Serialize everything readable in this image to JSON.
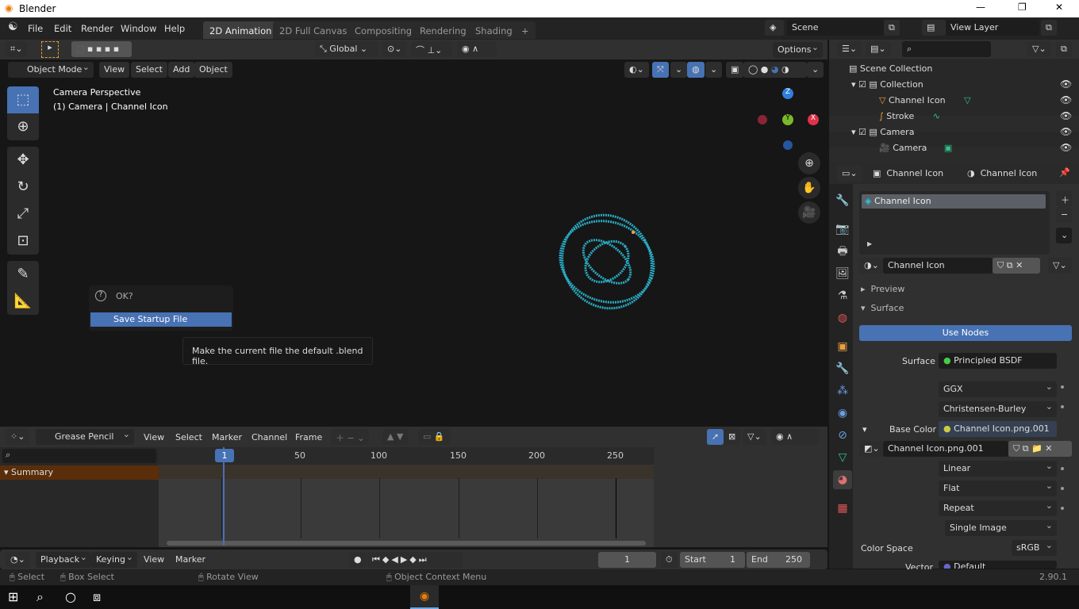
{
  "window": {
    "title": "Blender",
    "controls": [
      "—",
      "❐",
      "✕"
    ]
  },
  "menu": [
    "File",
    "Edit",
    "Render",
    "Window",
    "Help"
  ],
  "workspaces": [
    "2D Animation",
    "2D Full Canvas",
    "Compositing",
    "Rendering",
    "Shading",
    "+"
  ],
  "scene": {
    "label": "Scene",
    "view_layer": "View Layer"
  },
  "tool_header": {
    "orientation": "Global",
    "options": "Options"
  },
  "viewport_header": {
    "mode": "Object Mode",
    "menus": [
      "View",
      "Select",
      "Add",
      "Object"
    ]
  },
  "viewport": {
    "info_line1": "Camera Perspective",
    "info_line2": "(1) Camera | Channel Icon",
    "gizmo": {
      "z": "Z",
      "y": "Y",
      "x": "X"
    }
  },
  "dialog": {
    "question": "OK?",
    "action": "Save Startup File"
  },
  "tooltip": "Make the current file the default .blend file.",
  "outliner": {
    "items": [
      {
        "label": "Scene Collection"
      },
      {
        "label": "Collection"
      },
      {
        "label": "Channel Icon"
      },
      {
        "label": "Stroke"
      },
      {
        "label": "Camera"
      },
      {
        "label": "Camera"
      }
    ]
  },
  "properties": {
    "breadcrumb_object": "Channel Icon",
    "breadcrumb_material": "Channel Icon",
    "slot": "Channel Icon",
    "material_name": "Channel Icon",
    "preview": "Preview",
    "surface_panel": "Surface",
    "use_nodes": "Use Nodes",
    "surface_label": "Surface",
    "surface_value": "Principled BSDF",
    "distribution": "GGX",
    "subsurface": "Christensen-Burley",
    "base_color_label": "Base Color",
    "base_color_value": "Channel Icon.png.001",
    "image": "Channel Icon.png.001",
    "interpolation": "Linear",
    "projection": "Flat",
    "extension": "Repeat",
    "source": "Single Image",
    "color_space_label": "Color Space",
    "color_space": "sRGB",
    "vector_label": "Vector",
    "vector_value": "Default"
  },
  "dopesheet": {
    "mode": "Grease Pencil",
    "menus": [
      "View",
      "Select",
      "Marker",
      "Channel",
      "Frame"
    ],
    "summary": "Summary",
    "current_frame": "1",
    "ticks": [
      "50",
      "100",
      "150",
      "200",
      "250"
    ]
  },
  "timeline": {
    "playback": "Playback",
    "keying": "Keying",
    "view": "View",
    "marker": "Marker",
    "frame": "1",
    "start_label": "Start",
    "start": "1",
    "end_label": "End",
    "end": "250"
  },
  "statusbar": {
    "select": "Select",
    "box_select": "Box Select",
    "rotate": "Rotate View",
    "context": "Object Context Menu",
    "version": "2.90.1"
  },
  "colors": {
    "accent": "#4772b3",
    "summary": "#5a2e0a",
    "playhead": "#4772b3",
    "viewport_bg": "#161616",
    "object": "#2ec4e0"
  }
}
